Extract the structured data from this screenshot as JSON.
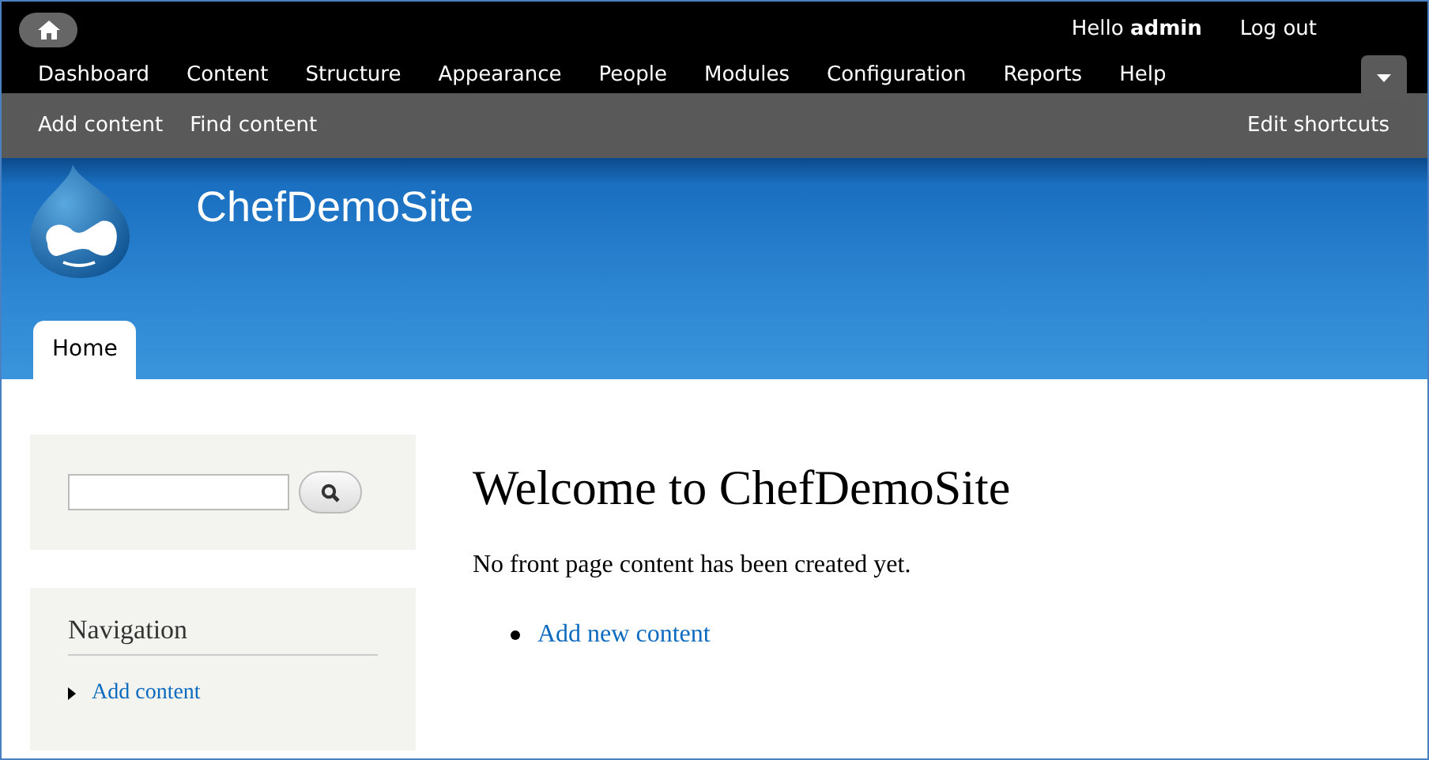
{
  "toolbar": {
    "greeting": "Hello **admin**",
    "logout": "Log out",
    "menu": [
      "Dashboard",
      "Content",
      "Structure",
      "Appearance",
      "People",
      "Modules",
      "Configuration",
      "Reports",
      "Help"
    ],
    "shortcuts": [
      "Add content",
      "Find content"
    ],
    "edit_shortcuts": "Edit shortcuts"
  },
  "header": {
    "site_name": "ChefDemoSite",
    "tabs": [
      {
        "label": "Home",
        "selected": true
      }
    ]
  },
  "sidebar": {
    "navigation": {
      "title": "Navigation",
      "items": [
        "Add content"
      ]
    }
  },
  "main": {
    "title": "Welcome to ChefDemoSite",
    "message": "No front page content has been created yet.",
    "links": [
      "Add new content"
    ]
  }
}
